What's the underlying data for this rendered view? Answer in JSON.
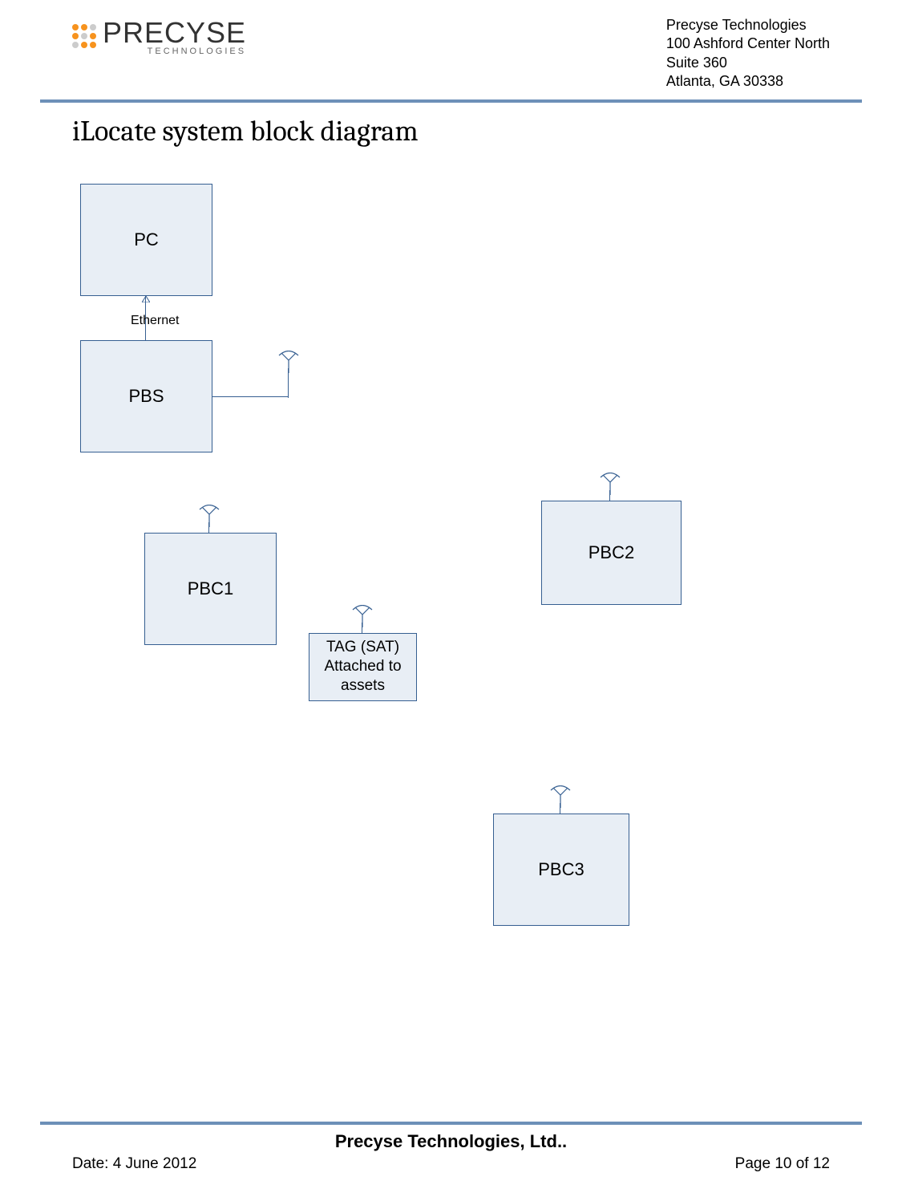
{
  "header": {
    "company": "Precyse Technologies",
    "address1": "100 Ashford Center North",
    "address2": "Suite 360",
    "address3": "Atlanta, GA  30338",
    "logo_main": "PRECYSE",
    "logo_sub": "TECHNOLOGIES"
  },
  "title": "iLocate system block diagram",
  "diagram": {
    "pc": "PC",
    "pbs": "PBS",
    "ethernet": "Ethernet",
    "pbc1": "PBC1",
    "pbc2": "PBC2",
    "pbc3": "PBC3",
    "tag": "TAG (SAT)\nAttached to assets"
  },
  "footer": {
    "company": "Precyse Technologies, Ltd..",
    "date": "Date: 4 June 2012",
    "page": "Page 10 of 12"
  }
}
